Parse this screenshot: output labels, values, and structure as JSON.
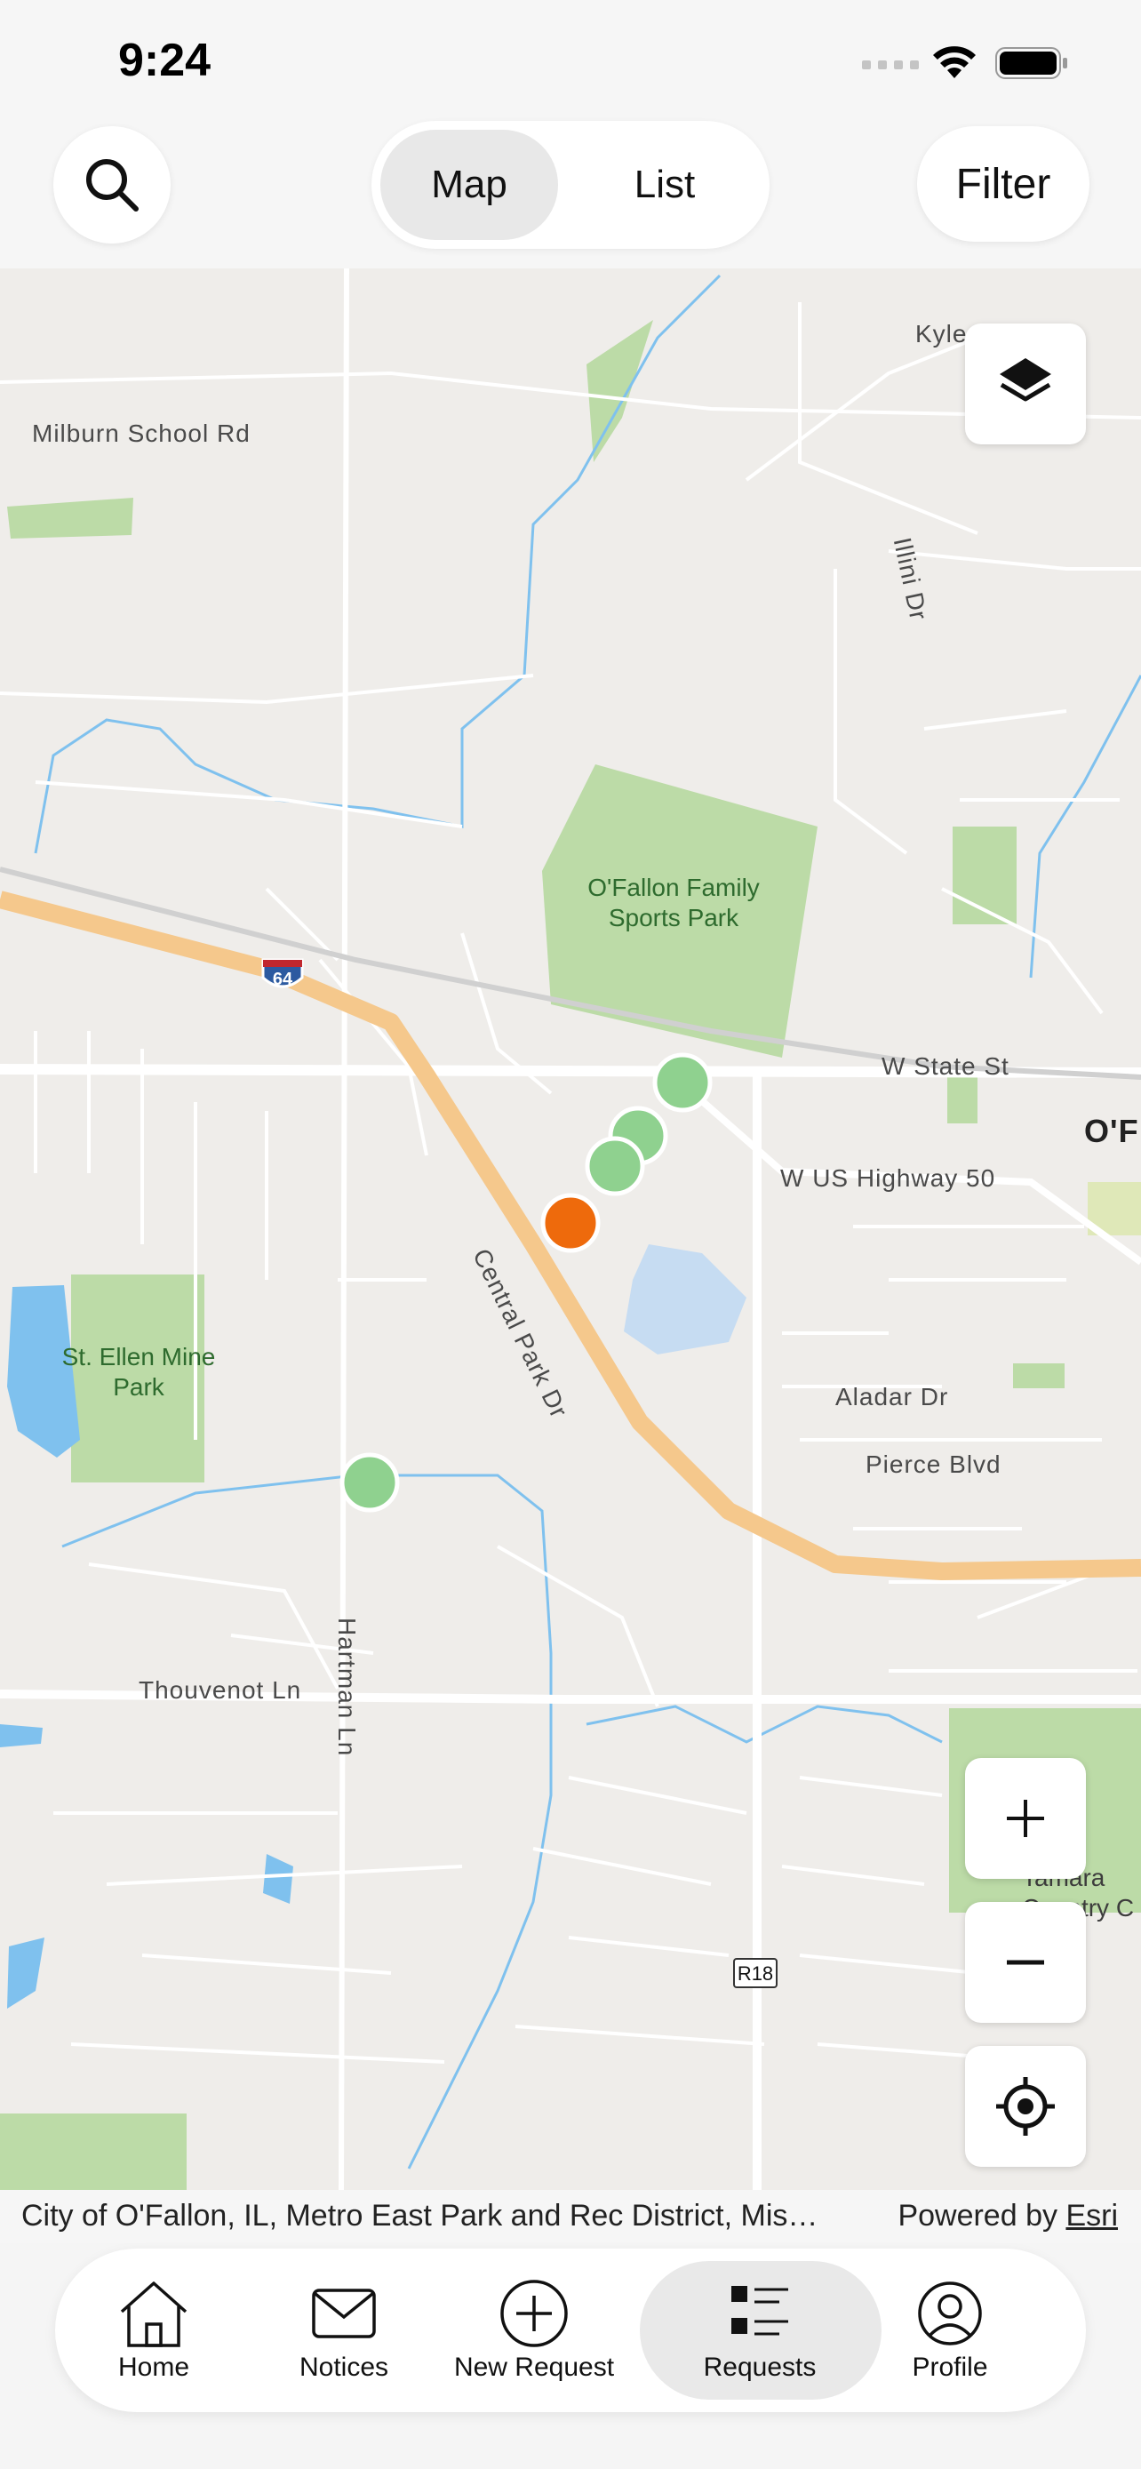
{
  "status_bar": {
    "time": "9:24"
  },
  "top_bar": {
    "segments": [
      {
        "label": "Map",
        "selected": true
      },
      {
        "label": "List",
        "selected": false
      }
    ],
    "filter_label": "Filter"
  },
  "map": {
    "road_labels": {
      "milburn": "Milburn School Rd",
      "kyle": "Kyle",
      "illini": "Illini Dr",
      "state": "W State St",
      "us50": "W US Highway 50",
      "central": "Central Park Dr",
      "aladar": "Aladar Dr",
      "pierce": "Pierce Blvd",
      "thouvenot": "Thouvenot Ln",
      "hartman": "Hartman Ln"
    },
    "place_labels": {
      "ofallon_city": "O'F",
      "sports_park": "O'Fallon Family Sports Park",
      "st_ellen": "St. Ellen Mine Park",
      "tamara": "Tamara Country C"
    },
    "shields": {
      "interstate": "64",
      "route": "R18"
    },
    "markers": [
      {
        "status": "open",
        "color": "#8fd18f"
      },
      {
        "status": "open",
        "color": "#8fd18f"
      },
      {
        "status": "open",
        "color": "#8fd18f"
      },
      {
        "status": "selected",
        "color": "#ee6a0c"
      },
      {
        "status": "open",
        "color": "#8fd18f"
      }
    ]
  },
  "attribution": {
    "sources": "City of O'Fallon, IL, Metro East Park and Rec District, Mis…",
    "powered_by": "Powered by",
    "esri": "Esri"
  },
  "tab_bar": {
    "tabs": [
      {
        "label": "Home",
        "icon": "house-icon"
      },
      {
        "label": "Notices",
        "icon": "envelope-icon"
      },
      {
        "label": "New Request",
        "icon": "plus-circle-icon"
      },
      {
        "label": "Requests",
        "icon": "list-icon",
        "active": true
      },
      {
        "label": "Profile",
        "icon": "person-circle-icon"
      }
    ]
  }
}
